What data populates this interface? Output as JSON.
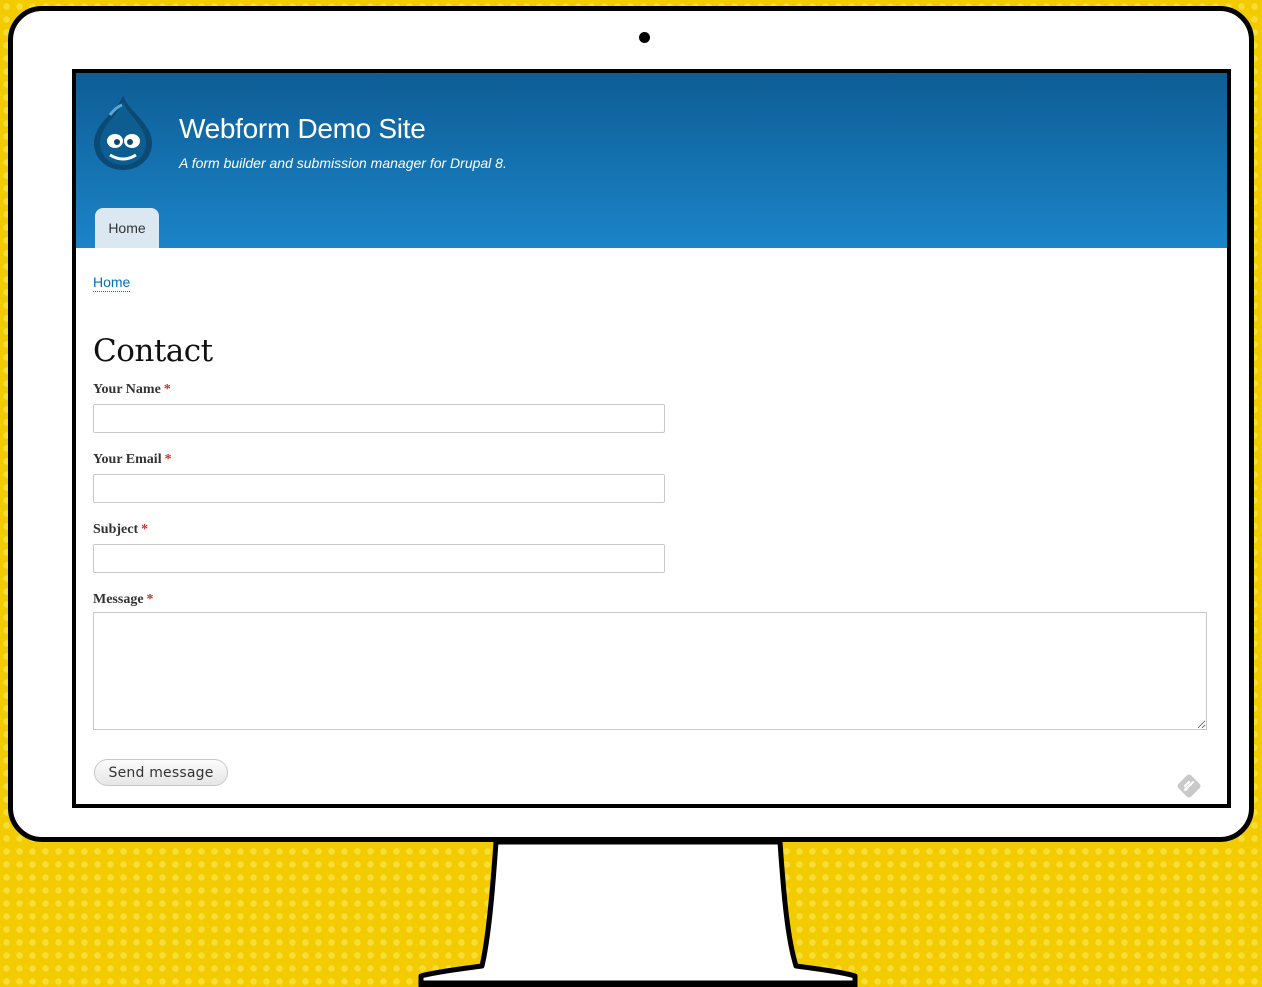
{
  "site": {
    "name": "Webform Demo Site",
    "slogan": "A form builder and submission manager for Drupal 8."
  },
  "nav": {
    "tabs": [
      {
        "label": "Home",
        "active": true
      }
    ]
  },
  "breadcrumb": {
    "items": [
      "Home"
    ]
  },
  "page": {
    "title": "Contact"
  },
  "form": {
    "required_marker": "*",
    "fields": {
      "name": {
        "label": "Your Name",
        "value": ""
      },
      "email": {
        "label": "Your Email",
        "value": ""
      },
      "subject": {
        "label": "Subject",
        "value": ""
      },
      "message": {
        "label": "Message",
        "value": ""
      }
    },
    "submit_label": "Send message"
  },
  "icons": {
    "logo": "drupal-drop-logo",
    "camera": "webcam-dot",
    "feed": "rss-feed-icon"
  },
  "colors": {
    "header_top": "#0e5d95",
    "header_bottom": "#1b84c8",
    "link": "#0071b3",
    "required": "#c0342b",
    "background": "#f2cc00"
  }
}
